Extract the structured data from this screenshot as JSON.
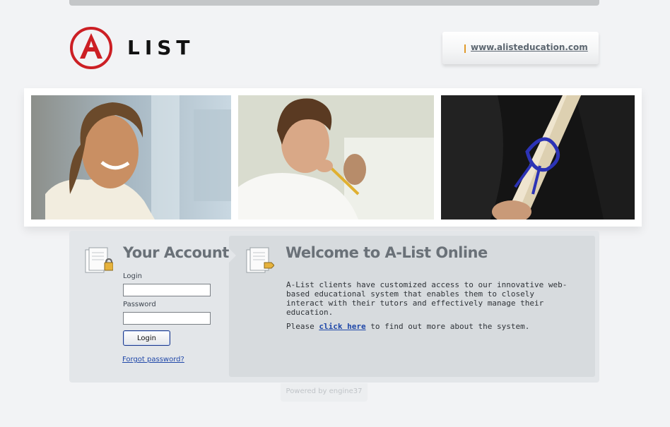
{
  "header": {
    "logo_text": "LIST",
    "logo_letter": "A",
    "site_url": "www.alisteducation.com"
  },
  "photos": [
    {
      "icon": "smiling-student-photo"
    },
    {
      "icon": "student-thinking-photo"
    },
    {
      "icon": "diploma-photo"
    }
  ],
  "account": {
    "title": "Your Account",
    "login_label": "Login",
    "login_value": "",
    "password_label": "Password",
    "password_value": "",
    "login_button": "Login",
    "forgot_link": "Forgot password?"
  },
  "welcome": {
    "title": "Welcome to A-List Online",
    "body": "A-List clients have customized access to our innovative web-based educational system that enables them to closely interact with their tutors and effectively manage their education.",
    "para2_before": "Please ",
    "para2_link": "click here",
    "para2_after": " to find out more about the system."
  },
  "footer": {
    "powered_by": "Powered by engine37"
  },
  "colors": {
    "brand_red": "#cc1f24",
    "accent_orange": "#e09a2b",
    "link_blue": "#1f47a8"
  }
}
